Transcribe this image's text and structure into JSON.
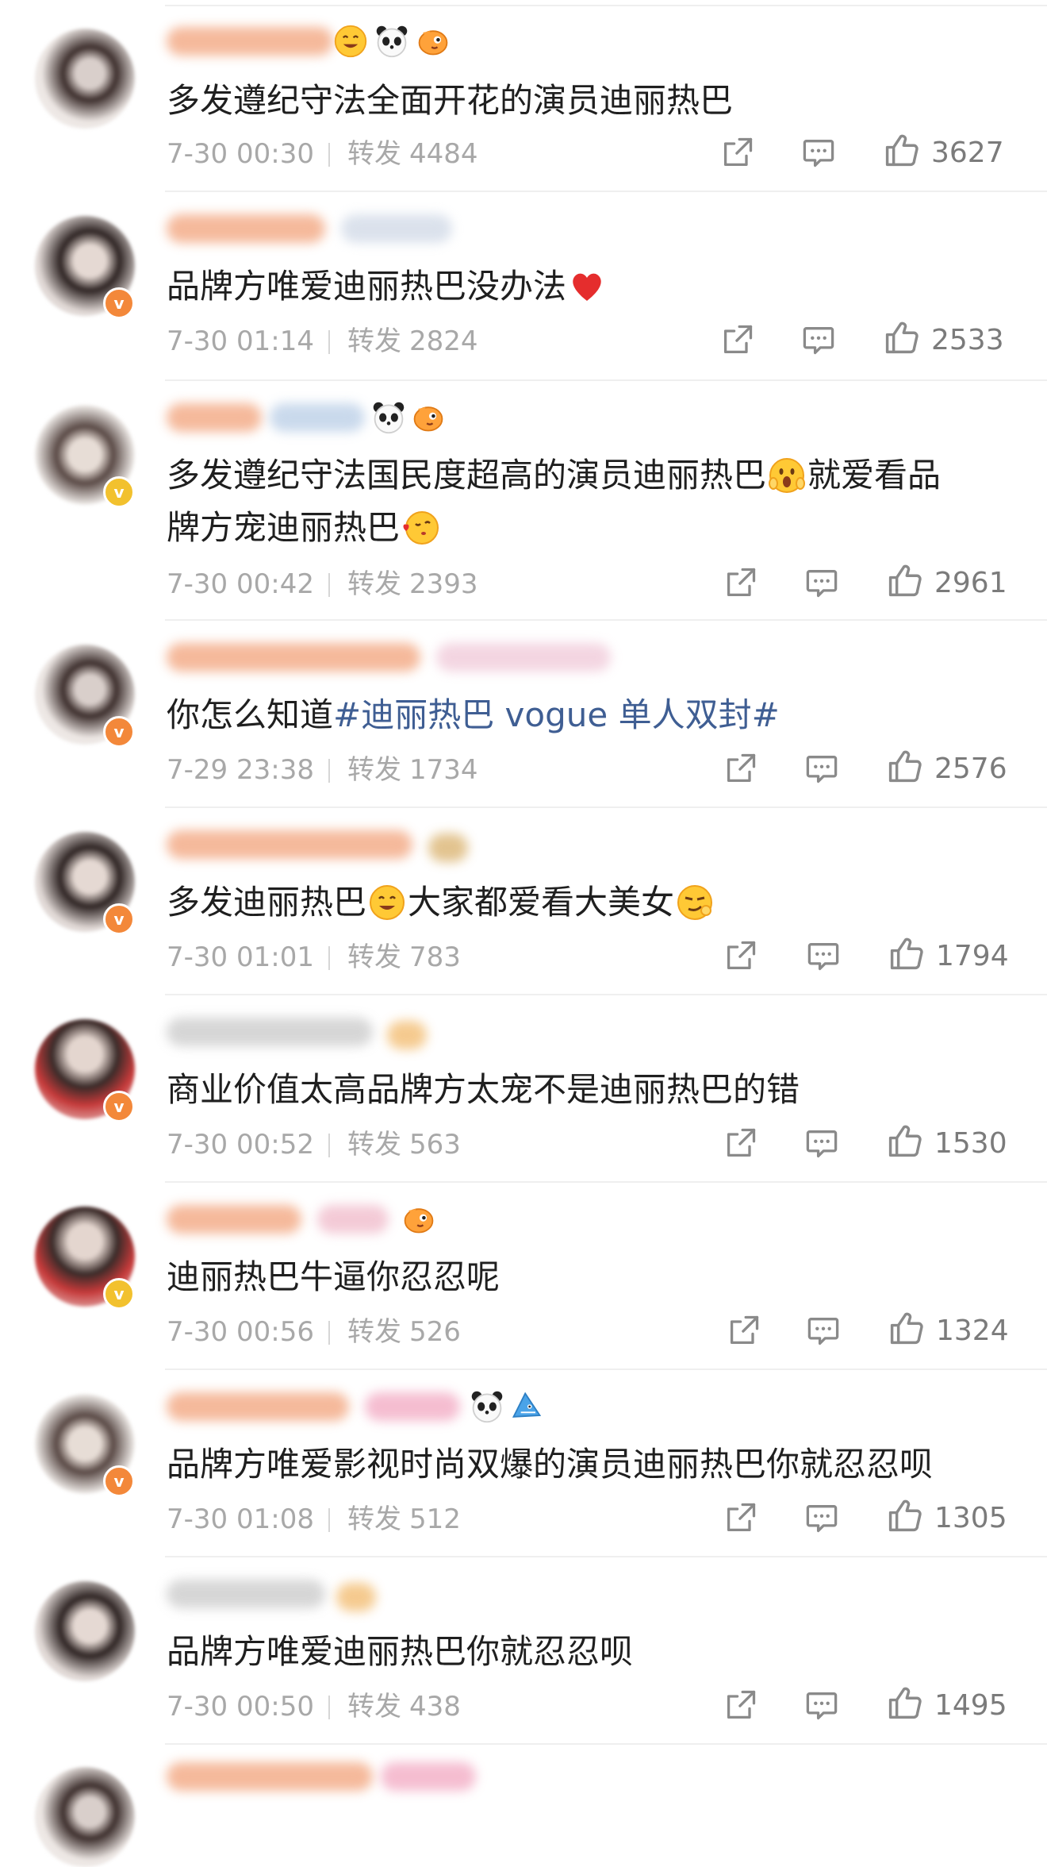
{
  "comments": [
    {
      "text": "多发遵纪守法全面开花的演员迪丽热巴",
      "time": "7-30 00:30",
      "forward_label": "转发",
      "forward_count": "4484",
      "likes": "3627"
    },
    {
      "text": "品牌方唯爱迪丽热巴没办法",
      "time": "7-30 01:14",
      "forward_label": "转发",
      "forward_count": "2824",
      "likes": "2533"
    },
    {
      "text_line1": "多发遵纪守法国民度超高的演员迪丽热巴",
      "text_line1_tail": "就爱看品",
      "text_line2": "牌方宠迪丽热巴",
      "time": "7-30 00:42",
      "forward_label": "转发",
      "forward_count": "2393",
      "likes": "2961"
    },
    {
      "text_prefix": "你怎么知道",
      "hashtag": "#迪丽热巴 vogue 单人双封#",
      "time": "7-29 23:38",
      "forward_label": "转发",
      "forward_count": "1734",
      "likes": "2576"
    },
    {
      "text_part1": "多发迪丽热巴",
      "text_part2": "大家都爱看大美女",
      "time": "7-30 01:01",
      "forward_label": "转发",
      "forward_count": "783",
      "likes": "1794"
    },
    {
      "text": "商业价值太高品牌方太宠不是迪丽热巴的错",
      "time": "7-30 00:52",
      "forward_label": "转发",
      "forward_count": "563",
      "likes": "1530"
    },
    {
      "text": "迪丽热巴牛逼你忍忍呢",
      "time": "7-30 00:56",
      "forward_label": "转发",
      "forward_count": "526",
      "likes": "1324"
    },
    {
      "text": "品牌方唯爱影视时尚双爆的演员迪丽热巴你就忍忍呗",
      "time": "7-30 01:08",
      "forward_label": "转发",
      "forward_count": "512",
      "likes": "1305"
    },
    {
      "text": "品牌方唯爱迪丽热巴你就忍忍呗",
      "time": "7-30 00:50",
      "forward_label": "转发",
      "forward_count": "438",
      "likes": "1495"
    }
  ],
  "colors": {
    "hashtag": "#3f5e93",
    "meta": "#a8a8a8",
    "badge_orange": "#f3883a",
    "badge_yellow": "#f2c12e"
  },
  "icons": [
    "share-icon",
    "comment-icon",
    "like-icon"
  ]
}
